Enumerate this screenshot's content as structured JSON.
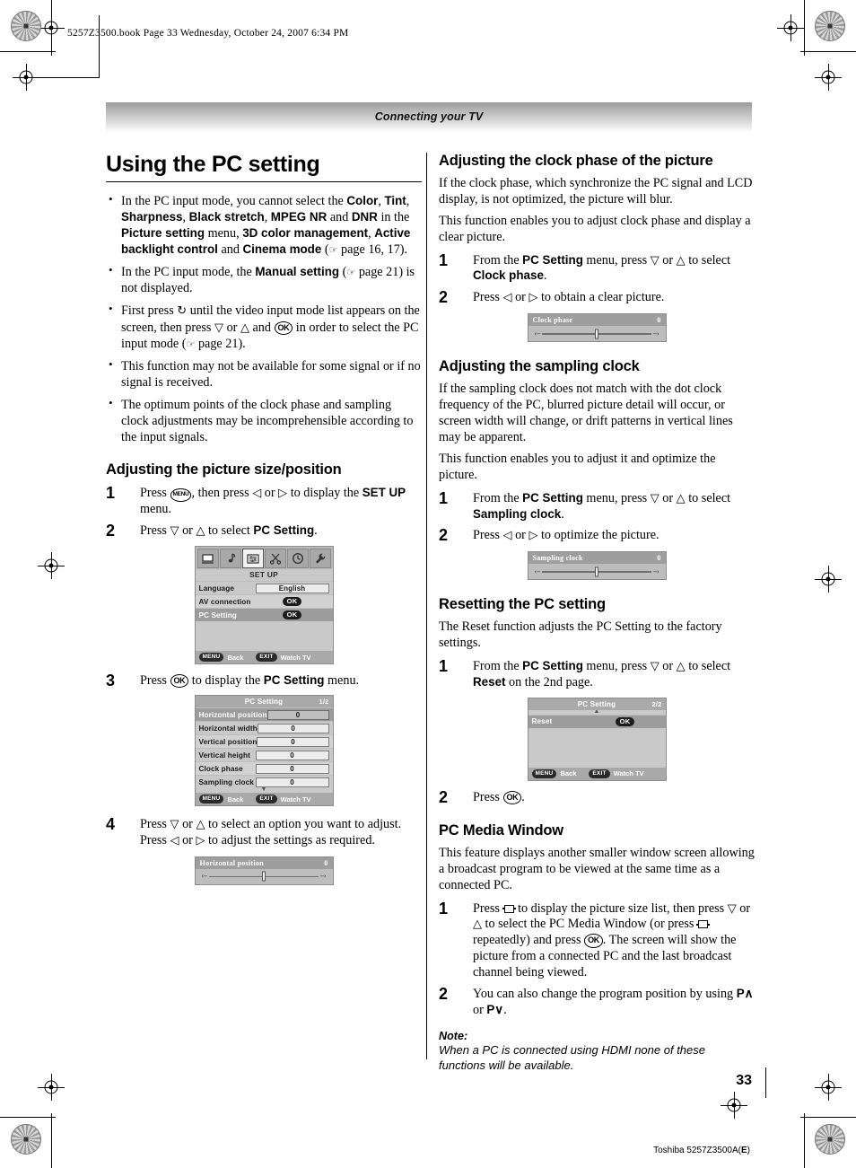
{
  "print": {
    "file_header": "5257Z3500.book  Page 33  Wednesday, October 24, 2007  6:34 PM",
    "page_number": "33",
    "doc_footer_prefix": "Toshiba 5257Z3500A(",
    "doc_footer_bold": "E",
    "doc_footer_suffix": ")"
  },
  "banner": {
    "title": "Connecting your TV"
  },
  "left": {
    "title": "Using the PC setting",
    "bullets": [
      {
        "parts": [
          {
            "t": "In the PC input mode, you cannot select the ",
            "b": false
          },
          {
            "t": "Color",
            "b": true
          },
          {
            "t": ", ",
            "b": false
          },
          {
            "t": "Tint",
            "b": true
          },
          {
            "t": ", ",
            "b": false
          },
          {
            "t": "Sharpness",
            "b": true
          },
          {
            "t": ", ",
            "b": false
          },
          {
            "t": "Black stretch",
            "b": true
          },
          {
            "t": ", ",
            "b": false
          },
          {
            "t": "MPEG NR",
            "b": true
          },
          {
            "t": " and ",
            "b": false
          },
          {
            "t": "DNR",
            "b": true
          },
          {
            "t": " in the ",
            "b": false
          },
          {
            "t": "Picture setting",
            "b": true
          },
          {
            "t": " menu, ",
            "b": false
          },
          {
            "t": "3D color management",
            "b": true
          },
          {
            "t": ", ",
            "b": false
          },
          {
            "t": "Active backlight control",
            "b": true
          },
          {
            "t": " and ",
            "b": false
          },
          {
            "t": "Cinema mode",
            "b": true
          },
          {
            "t": " (",
            "b": false
          },
          {
            "t": "POINTER",
            "icon": true
          },
          {
            "t": " page 16, 17).",
            "b": false
          }
        ]
      },
      {
        "parts": [
          {
            "t": "In the PC input mode, the ",
            "b": false
          },
          {
            "t": "Manual setting",
            "b": true
          },
          {
            "t": " (",
            "b": false
          },
          {
            "t": "POINTER",
            "icon": true
          },
          {
            "t": " page 21) is not displayed.",
            "b": false
          }
        ]
      },
      {
        "parts": [
          {
            "t": "First press ",
            "b": false
          },
          {
            "t": "INPUT",
            "icon": true
          },
          {
            "t": " until the video input mode list appears on the screen, then press ",
            "b": false
          },
          {
            "t": "DOWN",
            "icon": true
          },
          {
            "t": " or ",
            "b": false
          },
          {
            "t": "UP",
            "icon": true
          },
          {
            "t": " and ",
            "b": false
          },
          {
            "t": "OK",
            "icon": true
          },
          {
            "t": " in order to select the PC input mode (",
            "b": false
          },
          {
            "t": "POINTER",
            "icon": true
          },
          {
            "t": " page 21).",
            "b": false
          }
        ]
      },
      {
        "parts": [
          {
            "t": "This function may not be available for some signal or if no signal is received.",
            "b": false
          }
        ]
      },
      {
        "parts": [
          {
            "t": "The optimum points of the clock phase and sampling clock adjustments may be incomprehensible according to the input signals.",
            "b": false
          }
        ]
      }
    ],
    "section_size_position": {
      "heading": "Adjusting the picture size/position",
      "steps": [
        {
          "n": "1",
          "parts": [
            {
              "t": "Press ",
              "b": false
            },
            {
              "t": "MENU",
              "icon": true
            },
            {
              "t": ", then press ",
              "b": false
            },
            {
              "t": "LEFT",
              "icon": true
            },
            {
              "t": " or ",
              "b": false
            },
            {
              "t": "RIGHT",
              "icon": true
            },
            {
              "t": " to display the ",
              "b": false
            },
            {
              "t": "SET UP",
              "b": true
            },
            {
              "t": " menu.",
              "b": false
            }
          ]
        },
        {
          "n": "2",
          "parts": [
            {
              "t": "Press ",
              "b": false
            },
            {
              "t": "DOWN",
              "icon": true
            },
            {
              "t": " or ",
              "b": false
            },
            {
              "t": "UP",
              "icon": true
            },
            {
              "t": " to select ",
              "b": false
            },
            {
              "t": "PC Setting",
              "b": true
            },
            {
              "t": ".",
              "b": false
            }
          ]
        },
        {
          "n": "3",
          "parts": [
            {
              "t": "Press ",
              "b": false
            },
            {
              "t": "OK",
              "icon": true
            },
            {
              "t": " to display the ",
              "b": false
            },
            {
              "t": "PC Setting",
              "b": true
            },
            {
              "t": " menu.",
              "b": false
            }
          ]
        },
        {
          "n": "4",
          "parts": [
            {
              "t": "Press ",
              "b": false
            },
            {
              "t": "DOWN",
              "icon": true
            },
            {
              "t": " or ",
              "b": false
            },
            {
              "t": "UP",
              "icon": true
            },
            {
              "t": " to select an option you want to adjust. Press ",
              "b": false
            },
            {
              "t": "LEFT",
              "icon": true
            },
            {
              "t": " or ",
              "b": false
            },
            {
              "t": "RIGHT",
              "icon": true
            },
            {
              "t": " to adjust the settings as required.",
              "b": false
            }
          ]
        }
      ]
    }
  },
  "right": {
    "section_clock_phase": {
      "heading": "Adjusting the clock phase of the picture",
      "paragraphs": [
        "If the clock phase, which synchronize the PC signal and LCD display, is not optimized, the picture will blur.",
        "This function enables you to adjust clock phase and display a clear picture."
      ],
      "steps": [
        {
          "n": "1",
          "parts": [
            {
              "t": "From the ",
              "b": false
            },
            {
              "t": "PC Setting",
              "b": true
            },
            {
              "t": " menu, press ",
              "b": false
            },
            {
              "t": "DOWN",
              "icon": true
            },
            {
              "t": " or ",
              "b": false
            },
            {
              "t": "UP",
              "icon": true
            },
            {
              "t": " to select ",
              "b": false
            },
            {
              "t": "Clock phase",
              "b": true
            },
            {
              "t": ".",
              "b": false
            }
          ]
        },
        {
          "n": "2",
          "parts": [
            {
              "t": "Press ",
              "b": false
            },
            {
              "t": "LEFT",
              "icon": true
            },
            {
              "t": " or ",
              "b": false
            },
            {
              "t": "RIGHT",
              "icon": true
            },
            {
              "t": " to obtain a clear picture.",
              "b": false
            }
          ]
        }
      ]
    },
    "section_sampling_clock": {
      "heading": "Adjusting the sampling clock",
      "paragraphs": [
        "If the sampling clock does not match with the dot clock frequency of the PC, blurred picture detail will occur, or screen width will change, or drift patterns in vertical lines may be apparent.",
        "This function enables you to adjust it and optimize the picture."
      ],
      "steps": [
        {
          "n": "1",
          "parts": [
            {
              "t": "From the ",
              "b": false
            },
            {
              "t": "PC Setting",
              "b": true
            },
            {
              "t": " menu, press ",
              "b": false
            },
            {
              "t": "DOWN",
              "icon": true
            },
            {
              "t": " or ",
              "b": false
            },
            {
              "t": "UP",
              "icon": true
            },
            {
              "t": " to select ",
              "b": false
            },
            {
              "t": "Sampling clock",
              "b": true
            },
            {
              "t": ".",
              "b": false
            }
          ]
        },
        {
          "n": "2",
          "parts": [
            {
              "t": "Press ",
              "b": false
            },
            {
              "t": "LEFT",
              "icon": true
            },
            {
              "t": " or ",
              "b": false
            },
            {
              "t": "RIGHT",
              "icon": true
            },
            {
              "t": " to optimize the picture.",
              "b": false
            }
          ]
        }
      ]
    },
    "section_reset": {
      "heading": "Resetting the PC setting",
      "paragraphs": [
        "The Reset function adjusts the PC Setting to the factory settings."
      ],
      "steps": [
        {
          "n": "1",
          "parts": [
            {
              "t": "From the ",
              "b": false
            },
            {
              "t": "PC Setting",
              "b": true
            },
            {
              "t": " menu, press ",
              "b": false
            },
            {
              "t": "DOWN",
              "icon": true
            },
            {
              "t": " or ",
              "b": false
            },
            {
              "t": "UP",
              "icon": true
            },
            {
              "t": " to select ",
              "b": false
            },
            {
              "t": "Reset",
              "b": true
            },
            {
              "t": " on the 2nd page.",
              "b": false
            }
          ]
        },
        {
          "n": "2",
          "parts": [
            {
              "t": "Press ",
              "b": false
            },
            {
              "t": "OK",
              "icon": true
            },
            {
              "t": ".",
              "b": false
            }
          ]
        }
      ]
    },
    "section_pc_media": {
      "heading": "PC Media Window",
      "paragraphs": [
        "This feature displays another smaller window screen allowing a broadcast program to be viewed at the same time as a connected PC."
      ],
      "steps": [
        {
          "n": "1",
          "parts": [
            {
              "t": "Press ",
              "b": false
            },
            {
              "t": "PICSIZE",
              "icon": true
            },
            {
              "t": " to display the picture size list, then press ",
              "b": false
            },
            {
              "t": "DOWN",
              "icon": true
            },
            {
              "t": " or ",
              "b": false
            },
            {
              "t": "UP",
              "icon": true
            },
            {
              "t": " to select the PC Media Window (or press ",
              "b": false
            },
            {
              "t": "PICSIZE",
              "icon": true
            },
            {
              "t": " repeatedly) and press ",
              "b": false
            },
            {
              "t": "OK",
              "icon": true
            },
            {
              "t": ". The screen will show the picture from a connected PC and the last broadcast channel being viewed.",
              "b": false
            }
          ]
        },
        {
          "n": "2",
          "parts": [
            {
              "t": "You can also change the program position by using ",
              "b": false
            },
            {
              "t": "PUP",
              "icon": true
            },
            {
              "t": " or ",
              "b": false
            },
            {
              "t": "PDOWN",
              "icon": true
            },
            {
              "t": ".",
              "b": false
            }
          ]
        }
      ],
      "note_label": "Note:",
      "note_text": "When a PC is connected using HDMI none of these functions will be available."
    }
  },
  "osd": {
    "setup_menu": {
      "title": "SET UP",
      "tabs": [
        "screen-icon",
        "music-note-icon",
        "setup-list-icon",
        "scissors-icon",
        "clock-icon",
        "wrench-icon"
      ],
      "selected_tab_index": 2,
      "rows": [
        {
          "label": "Language",
          "value": "English",
          "type": "value",
          "highlight": false
        },
        {
          "label": "AV connection",
          "value": "OK",
          "type": "ok",
          "highlight": false
        },
        {
          "label": "PC Setting",
          "value": "OK",
          "type": "ok",
          "highlight": true
        }
      ],
      "footer": {
        "menu_key": "MENU",
        "menu_label": "Back",
        "exit_key": "EXIT",
        "exit_label": "Watch TV"
      }
    },
    "pc_setting_menu": {
      "title": "PC Setting",
      "page": "1/2",
      "rows": [
        {
          "label": "Horizontal position",
          "value": "0",
          "highlight": true
        },
        {
          "label": "Horizontal width",
          "value": "0",
          "highlight": false
        },
        {
          "label": "Vertical position",
          "value": "0",
          "highlight": false
        },
        {
          "label": "Vertical height",
          "value": "0",
          "highlight": false
        },
        {
          "label": "Clock phase",
          "value": "0",
          "highlight": false
        },
        {
          "label": "Sampling clock",
          "value": "0",
          "highlight": false
        }
      ],
      "footer": {
        "menu_key": "MENU",
        "menu_label": "Back",
        "exit_key": "EXIT",
        "exit_label": "Watch TV"
      }
    },
    "pc_setting_menu_p2": {
      "title": "PC Setting",
      "page": "2/2",
      "rows": [
        {
          "label": "Reset",
          "value": "OK",
          "highlight": true
        }
      ],
      "footer": {
        "menu_key": "MENU",
        "menu_label": "Back",
        "exit_key": "EXIT",
        "exit_label": "Watch TV"
      }
    },
    "slider_horizontal_position": {
      "label": "Horizontal position",
      "value": "0",
      "left_mark": "‹–",
      "right_mark": "–›"
    },
    "slider_clock_phase": {
      "label": "Clock phase",
      "value": "0",
      "left_mark": "‹–",
      "right_mark": "–›"
    },
    "slider_sampling_clock": {
      "label": "Sampling clock",
      "value": "0",
      "left_mark": "‹–",
      "right_mark": "–›"
    }
  }
}
